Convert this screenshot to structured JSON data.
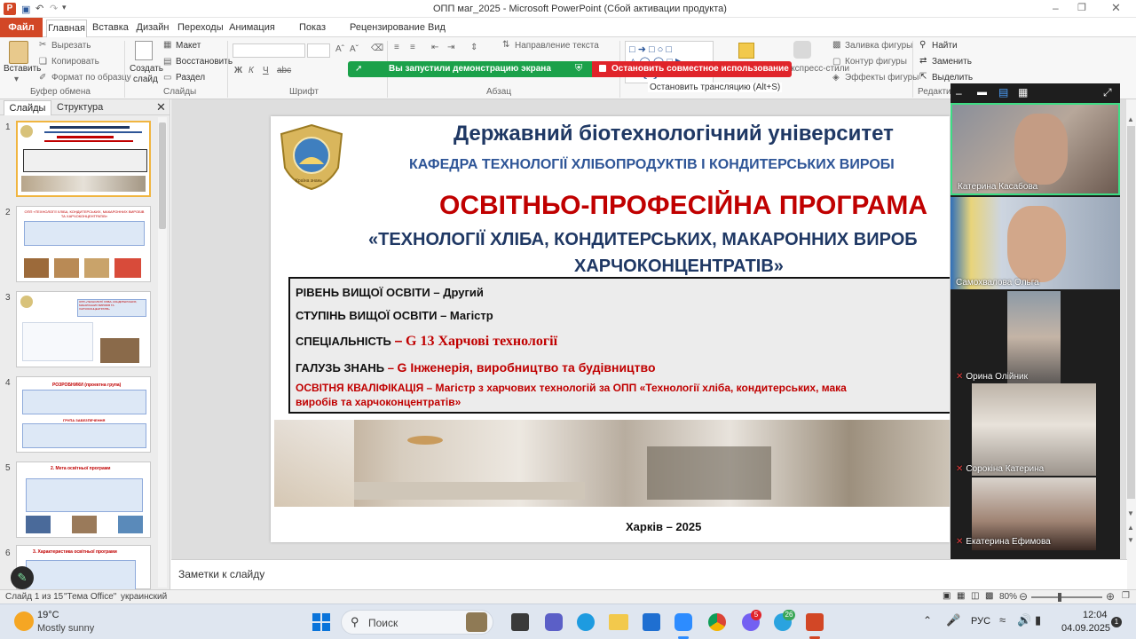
{
  "titlebar": {
    "title": "ОПП маг_2025  -  Microsoft PowerPoint (Сбой активации продукта)"
  },
  "tabs": [
    "Файл",
    "Главная",
    "Вставка",
    "Дизайн",
    "Переходы",
    "Анимация",
    "Показ слайдов",
    "Рецензирование",
    "Вид"
  ],
  "ribbon": {
    "paste": "Вставить",
    "cut": "Вырезать",
    "copy": "Копировать",
    "format_painter": "Формат по образцу",
    "clipboard_group": "Буфер обмена",
    "new_slide": "Создать",
    "new_slide2": "слайд",
    "layout": "Макет",
    "reset": "Восстановить",
    "section": "Раздел",
    "slides_group": "Слайды",
    "font_group": "Шрифт",
    "text_direction": "Направление текста",
    "paragraph_group": "Абзац",
    "shape_fill": "Заливка фигуры",
    "shape_outline": "Контур фигуры",
    "shape_effects": "Эффекты фигуры",
    "quick_styles": "Экспресс-стили",
    "find": "Найти",
    "replace": "Заменить",
    "select": "Выделить",
    "editing_group": "Редактир",
    "stop_broadcast": "Остановить трансляцию (Alt+S)"
  },
  "share_bar": {
    "running": "Вы запустили демонстрацию экрана",
    "stop": "Остановить совместное использование"
  },
  "panel": {
    "tab_slides": "Слайды",
    "tab_outline": "Структура",
    "slide_numbers": [
      "1",
      "2",
      "3",
      "4",
      "5",
      "6"
    ],
    "thumb2_title": "ОПП «ТЕХНОЛОГІЇ ХЛІБА, КОНДИТЕРСЬКИХ, МАКАРОННИХ ВИРОБІВ ТА ХАРЧОКОНЦЕНТРАТІВ»",
    "thumb3_title": "ОПП «ТЕХНОЛОГІЇ ХЛІБА, КОНДИТЕРСЬКИХ, МАКАРОННИХ ВИРОБІВ ТА ХАРЧОКОНЦЕНТРАТІВ»",
    "thumb4_title": "РОЗРОБНИКИ (проектна група)",
    "thumb4_sub": "ГРУПА ЗАБЕЗПЕЧЕННЯ",
    "thumb5_title": "2. Мета освітньої програми",
    "thumb6_title": "3. Характеристика освітньої програми"
  },
  "slide": {
    "university": "Державний біотехнологічний університет",
    "department": "КАФЕДРА ТЕХНОЛОГІЇ ХЛІБОПРОДУКТІВ І КОНДИТЕРСЬКИХ ВИРОБІ",
    "program_title": "ОСВІТНЬО-ПРОФЕСІЙНА ПРОГРАМА",
    "program_name1": "«ТЕХНОЛОГІЇ ХЛІБА, КОНДИТЕРСЬКИХ, МАКАРОННИХ ВИРОБ",
    "program_name2": "ХАРЧОКОНЦЕНТРАТІВ»",
    "level_label": "РІВЕНЬ ВИЩОЇ ОСВІТИ",
    "level_value": "– Другий",
    "degree_label": "СТУПІНЬ ВИЩОЇ ОСВІТИ",
    "degree_value": "– Магістр",
    "specialty_label": "СПЕЦІАЛЬНІСТЬ",
    "specialty_dash": "–",
    "specialty_value": "G 13 Харчові технології",
    "field_label": "ГАЛУЗЬ ЗНАНЬ",
    "field_dash": "–",
    "field_value": "G Інженерія, виробництво та будівництво",
    "qualification_line1": "ОСВІТНЯ КВАЛІФІКАЦІЯ – Магістр з харчових технологій за ОПП «Технології хліба, кондитерських, мака",
    "qualification_line2": "виробів та харчоконцентратів»",
    "city_year": "Харків – 2025",
    "logo_text": "Країна знань"
  },
  "notes": {
    "placeholder": "Заметки к слайду"
  },
  "statusbar": {
    "slide_of": "Слайд 1 из 15",
    "theme": "\"Тема Office\"",
    "language": "украинский",
    "zoom": "80%"
  },
  "participants": [
    {
      "name": "Катерина Касабова",
      "muted": false
    },
    {
      "name": "Самохвалова Ольга",
      "muted": false
    },
    {
      "name": "Орина Олійник",
      "muted": true
    },
    {
      "name": "Сорокіна Катерина",
      "muted": true
    },
    {
      "name": "Екатерина Ефимова",
      "muted": true
    }
  ],
  "taskbar": {
    "temperature": "19°C",
    "weather": "Mostly sunny",
    "search": "Поиск",
    "language": "РУС",
    "time": "12:04",
    "date": "04.09.2025",
    "badge_viber": "5",
    "badge_telegram": "26",
    "notif": "1"
  },
  "colors": {
    "ppt_orange": "#d24726",
    "title_blue": "#1f3864",
    "dept_blue": "#2e5597",
    "red": "#c00000",
    "share_green": "#1ba14a",
    "share_red": "#e0242a",
    "active_speaker": "#3ddc84"
  }
}
